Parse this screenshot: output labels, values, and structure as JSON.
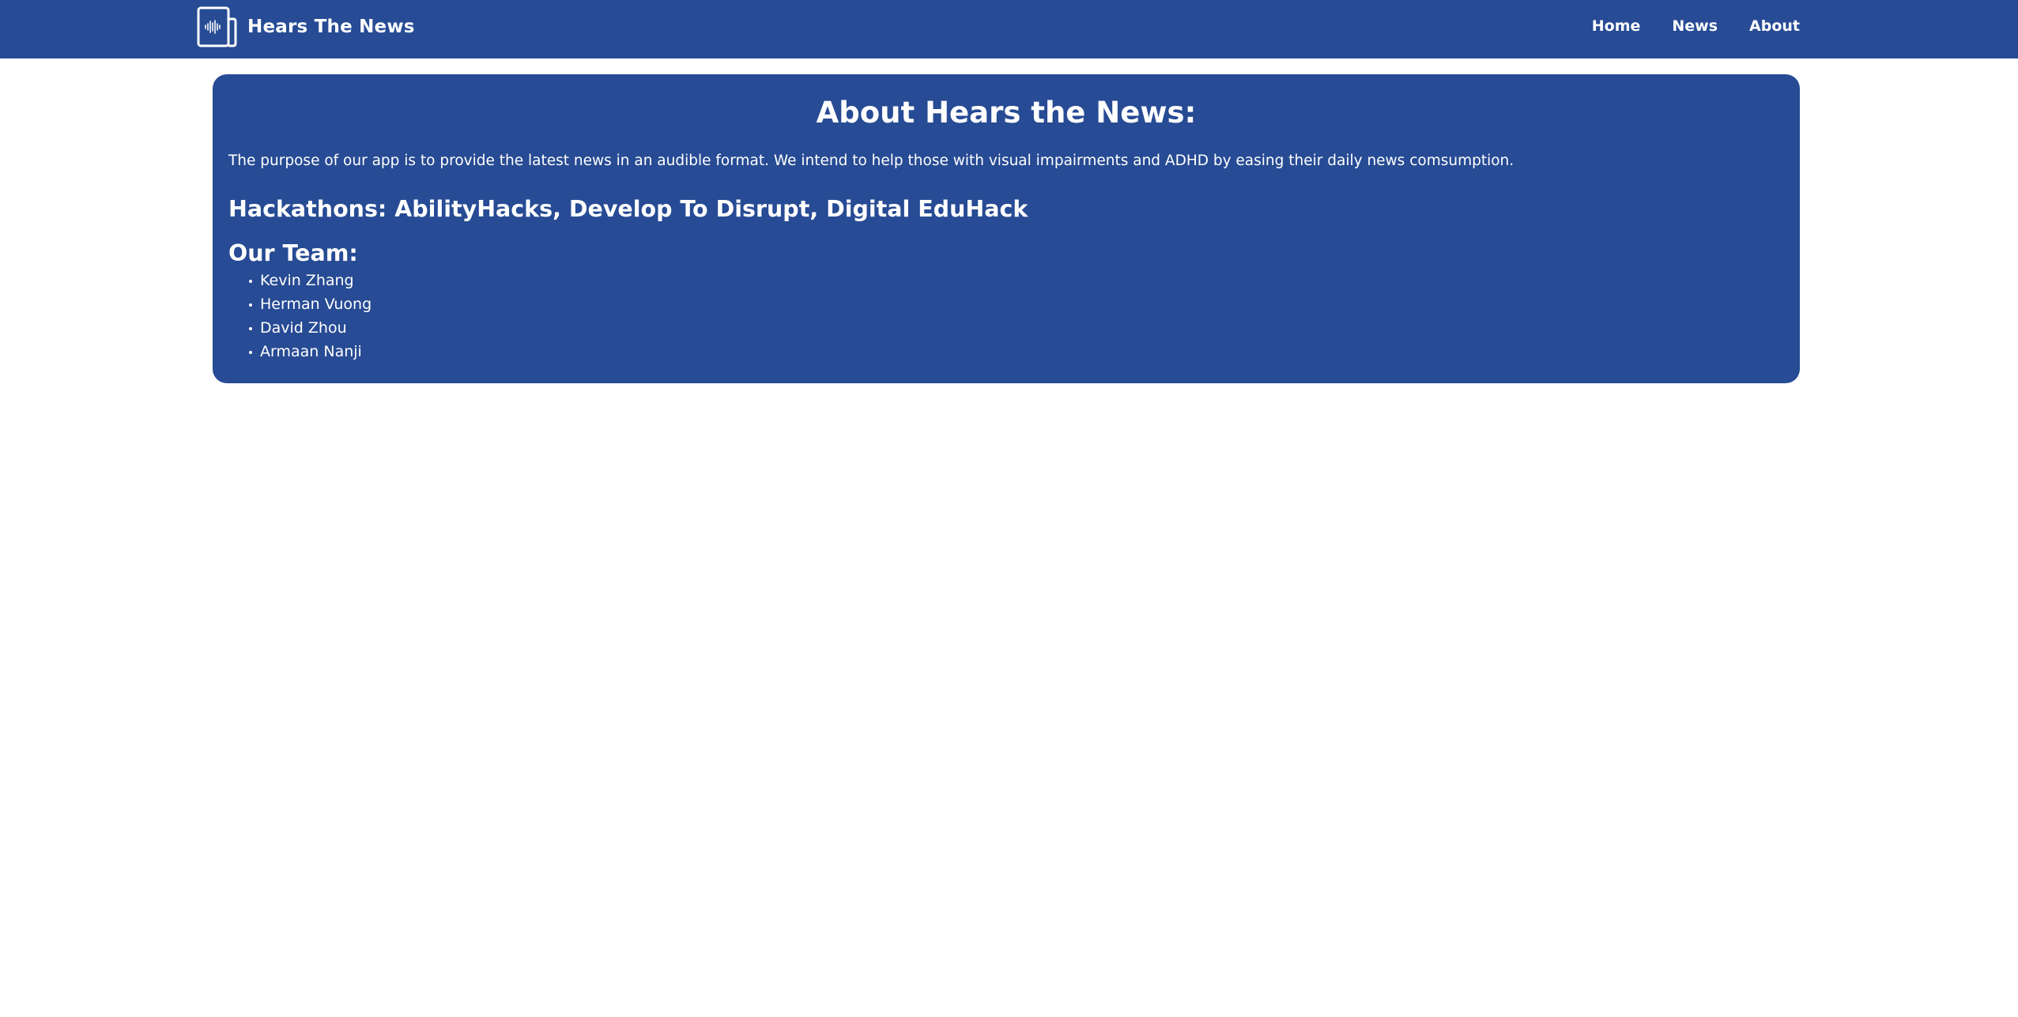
{
  "header": {
    "brand_name": "Hears The News",
    "logo_icon": "newspaper-sound-wave-icon",
    "nav": [
      {
        "label": "Home"
      },
      {
        "label": "News"
      },
      {
        "label": "About"
      }
    ]
  },
  "about": {
    "title": "About Hears the News:",
    "purpose": "The purpose of our app is to provide the latest news in an audible format. We intend to help those with visual impairments and ADHD by easing their daily news comsumption.",
    "hackathons": "Hackathons: AbilityHacks, Develop To Disrupt, Digital EduHack",
    "team_heading": "Our Team:",
    "team": [
      "Kevin Zhang",
      "Herman Vuong",
      "David Zhou",
      "Armaan Nanji"
    ]
  },
  "colors": {
    "primary": "#274b94",
    "text_on_primary": "#ffffff",
    "background": "#ffffff"
  }
}
